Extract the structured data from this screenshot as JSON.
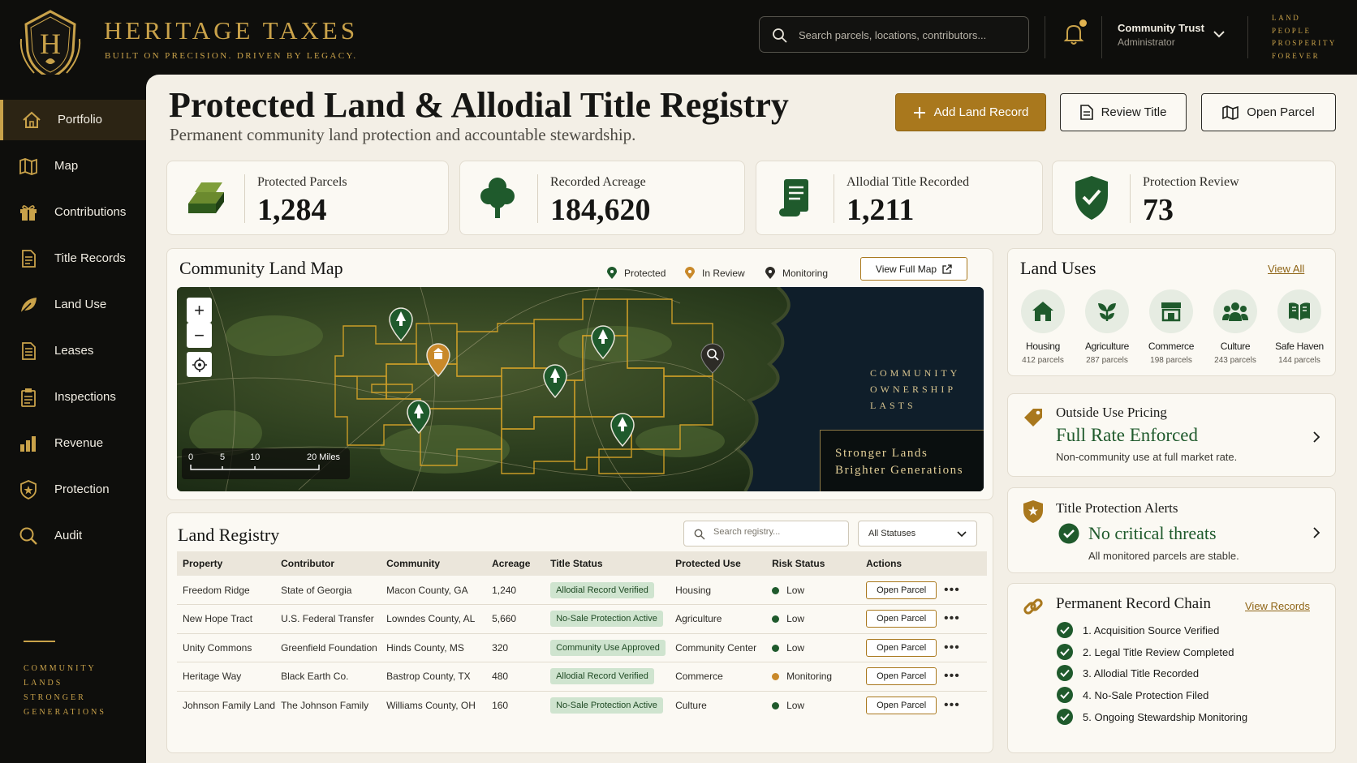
{
  "brand": {
    "name": "HERITAGE TAXES",
    "tagline": "BUILT ON PRECISION. DRIVEN BY LEGACY.",
    "logo_letter": "H"
  },
  "search": {
    "placeholder": "Search parcels, locations, contributors..."
  },
  "user": {
    "name": "Community Trust",
    "role": "Administrator"
  },
  "motto": [
    "LAND",
    "PEOPLE",
    "PROSPERITY",
    "FOREVER"
  ],
  "sidebar": {
    "items": [
      {
        "label": "Portfolio",
        "icon": "home-icon",
        "active": true
      },
      {
        "label": "Map",
        "icon": "map-icon"
      },
      {
        "label": "Contributions",
        "icon": "gift-icon"
      },
      {
        "label": "Title Records",
        "icon": "document-icon"
      },
      {
        "label": "Land Use",
        "icon": "leaf-icon"
      },
      {
        "label": "Leases",
        "icon": "lease-document-icon"
      },
      {
        "label": "Inspections",
        "icon": "clipboard-icon"
      },
      {
        "label": "Revenue",
        "icon": "bar-chart-icon"
      },
      {
        "label": "Protection",
        "icon": "shield-icon"
      },
      {
        "label": "Audit",
        "icon": "magnifier-icon"
      }
    ],
    "motto": [
      "COMMUNITY",
      "LANDS",
      "STRONGER",
      "GENERATIONS"
    ]
  },
  "header": {
    "title": "Protected Land & Allodial Title Registry",
    "subtitle": "Permanent community land protection and accountable stewardship.",
    "add_label": "Add Land Record",
    "review_label": "Review Title",
    "open_label": "Open Parcel"
  },
  "stats": [
    {
      "label": "Protected Parcels",
      "value": "1,284",
      "icon": "gold-bars-icon"
    },
    {
      "label": "Recorded Acreage",
      "value": "184,620",
      "icon": "tree-icon"
    },
    {
      "label": "Allodial Title Recorded",
      "value": "1,211",
      "icon": "scroll-icon"
    },
    {
      "label": "Protection Review",
      "value": "73",
      "icon": "shield-check-icon"
    }
  ],
  "map": {
    "title": "Community Land Map",
    "legend": [
      "Protected",
      "In Review",
      "Monitoring"
    ],
    "view_full": "View Full Map",
    "side_text": [
      "COMMUNITY",
      "OWNERSHIP",
      "LASTS"
    ],
    "banner": [
      "Stronger Lands",
      "Brighter Generations"
    ],
    "scale": [
      "0",
      "5",
      "10",
      "20 Miles"
    ]
  },
  "registry": {
    "title": "Land Registry",
    "search_placeholder": "Search registry...",
    "status_filter": "All Statuses",
    "columns": [
      "Property",
      "Contributor",
      "Community",
      "Acreage",
      "Title Status",
      "Protected Use",
      "Risk Status",
      "Actions"
    ],
    "rows": [
      {
        "property": "Freedom Ridge",
        "contributor": "State of Georgia",
        "community": "Macon County, GA",
        "acreage": "1,240",
        "status": "Allodial Record Verified",
        "use": "Housing",
        "risk": "Low",
        "risk_color": "#1f5a2c",
        "action": "Open Parcel"
      },
      {
        "property": "New Hope Tract",
        "contributor": "U.S. Federal Transfer",
        "community": "Lowndes County, AL",
        "acreage": "5,660",
        "status": "No-Sale Protection Active",
        "use": "Agriculture",
        "risk": "Low",
        "risk_color": "#1f5a2c",
        "action": "Open Parcel"
      },
      {
        "property": "Unity Commons",
        "contributor": "Greenfield Foundation",
        "community": "Hinds County, MS",
        "acreage": "320",
        "status": "Community Use Approved",
        "use": "Community Center",
        "risk": "Low",
        "risk_color": "#1f5a2c",
        "action": "Open Parcel"
      },
      {
        "property": "Heritage Way",
        "contributor": "Black Earth Co.",
        "community": "Bastrop County, TX",
        "acreage": "480",
        "status": "Allodial Record Verified",
        "use": "Commerce",
        "risk": "Monitoring",
        "risk_color": "#c9892a",
        "action": "Open Parcel"
      },
      {
        "property": "Johnson Family Land",
        "contributor": "The Johnson Family",
        "community": "Williams County, OH",
        "acreage": "160",
        "status": "No-Sale Protection Active",
        "use": "Culture",
        "risk": "Low",
        "risk_color": "#1f5a2c",
        "action": "Open Parcel"
      }
    ]
  },
  "land_uses": {
    "title": "Land Uses",
    "view_all": "View All",
    "items": [
      {
        "name": "Housing",
        "count": "412 parcels",
        "icon": "house-icon"
      },
      {
        "name": "Agriculture",
        "count": "287 parcels",
        "icon": "sprout-icon"
      },
      {
        "name": "Commerce",
        "count": "198 parcels",
        "icon": "storefront-icon"
      },
      {
        "name": "Culture",
        "count": "243 parcels",
        "icon": "people-icon"
      },
      {
        "name": "Safe Haven",
        "count": "144 parcels",
        "icon": "book-icon"
      }
    ]
  },
  "pricing": {
    "title": "Outside Use Pricing",
    "headline": "Full Rate Enforced",
    "note": "Non-community use at full market rate."
  },
  "alerts": {
    "title": "Title Protection Alerts",
    "headline": "No critical threats",
    "note": "All monitored parcels are stable."
  },
  "chain": {
    "title": "Permanent Record Chain",
    "view": "View Records",
    "steps": [
      "1. Acquisition Source Verified",
      "2. Legal Title Review Completed",
      "3. Allodial Title Recorded",
      "4. No-Sale Protection Filed",
      "5. Ongoing Stewardship Monitoring"
    ]
  },
  "colors": {
    "gold": "#c9a24a",
    "dark_green": "#1f5a2c",
    "bg": "#f3efe6",
    "sidebar": "#0e0e0c"
  }
}
